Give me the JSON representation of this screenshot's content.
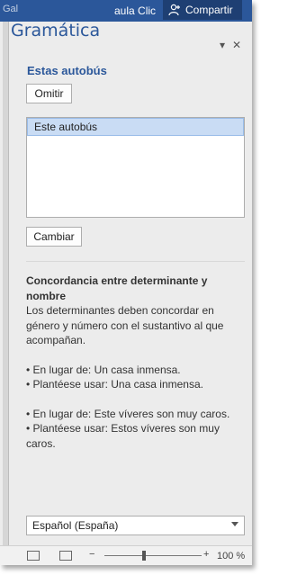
{
  "window": {
    "left_fragment": "Gal",
    "doc_name": "aula Clic",
    "share_label": "Compartir"
  },
  "pane": {
    "title": "Gramática",
    "collapse_glyph": "▾",
    "close_glyph": "✕",
    "error_phrase": "Estas autobús",
    "ignore_label": "Omitir",
    "suggestions": [
      "Este autobús"
    ],
    "change_label": "Cambiar"
  },
  "explanation": {
    "heading": "Concordancia entre determinante y nombre",
    "body": "Los determinantes deben concordar en género y número con el sustantivo al que acompañan.",
    "example1_wrong": "• En lugar de: Un casa inmensa.",
    "example1_right": "• Plantéese usar: Una casa inmensa.",
    "example2_wrong": "• En lugar de: Este víveres son muy caros.",
    "example2_right": "• Plantéese usar: Estos víveres son muy caros."
  },
  "language": {
    "selected": "Español (España)"
  },
  "statusbar": {
    "zoom_minus": "−",
    "zoom_plus": "+",
    "zoom_percent": "100 %",
    "zoom_level": 100
  },
  "colors": {
    "accent": "#2b579a",
    "selection": "#c9dcf4"
  }
}
